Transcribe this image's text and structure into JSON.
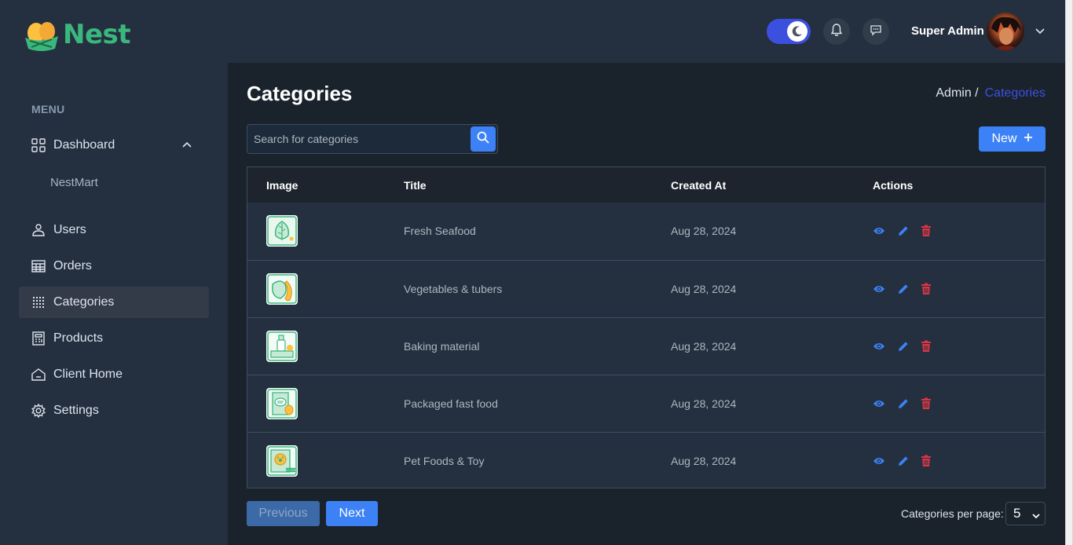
{
  "brand": {
    "name": "Nest"
  },
  "header": {
    "user_name": "Super Admin",
    "theme_toggle_on": true
  },
  "sidebar": {
    "menu_heading": "MENU",
    "items": [
      {
        "label": "Dashboard",
        "icon": "grid-icon",
        "expanded": true,
        "children": [
          {
            "label": "NestMart"
          }
        ]
      },
      {
        "label": "Users",
        "icon": "user-icon"
      },
      {
        "label": "Orders",
        "icon": "table-icon"
      },
      {
        "label": "Categories",
        "icon": "dotgrid-icon",
        "active": true
      },
      {
        "label": "Products",
        "icon": "calculator-icon"
      },
      {
        "label": "Client Home",
        "icon": "home-icon"
      },
      {
        "label": "Settings",
        "icon": "gear-icon"
      }
    ]
  },
  "main": {
    "title": "Categories",
    "breadcrumb": {
      "parent": "Admin /",
      "current": "Categories"
    },
    "search": {
      "placeholder": "Search for categories",
      "value": ""
    },
    "new_button": "New"
  },
  "table": {
    "columns": [
      "Image",
      "Title",
      "Created At",
      "Actions"
    ],
    "rows": [
      {
        "title": "Fresh Seafood",
        "created_at": "Aug 28, 2024",
        "image_icon": "leafy-greens-icon"
      },
      {
        "title": "Vegetables & tubers",
        "created_at": "Aug 28, 2024",
        "image_icon": "fruit-icon"
      },
      {
        "title": "Baking material",
        "created_at": "Aug 28, 2024",
        "image_icon": "groceries-icon"
      },
      {
        "title": "Packaged fast food",
        "created_at": "Aug 28, 2024",
        "image_icon": "snack-pack-icon"
      },
      {
        "title": "Pet Foods & Toy",
        "created_at": "Aug 28, 2024",
        "image_icon": "pet-food-icon"
      }
    ]
  },
  "pagination": {
    "previous": "Previous",
    "next": "Next",
    "per_page_label": "Categories per page:",
    "per_page_value": "5"
  },
  "colors": {
    "accent": "#3c50e0",
    "button": "#3c82f6",
    "delete": "#dc3545",
    "brand": "#3bb77e"
  }
}
